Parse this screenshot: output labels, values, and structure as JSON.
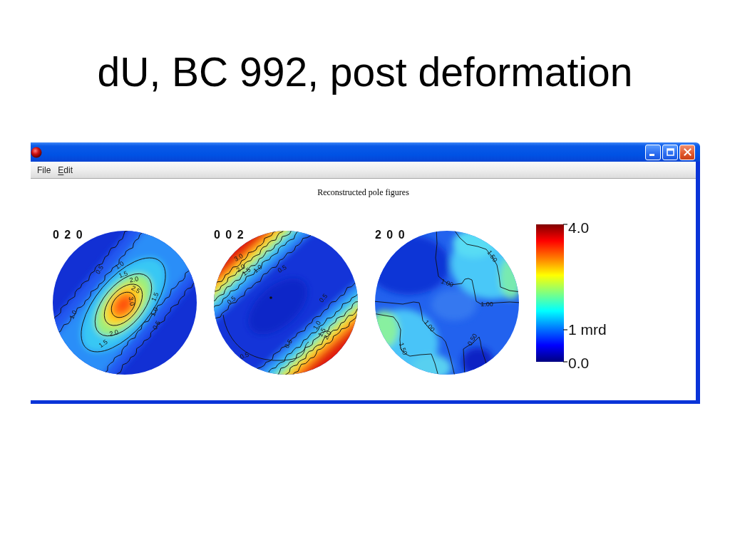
{
  "slide": {
    "title": "dU, BC 992, post deformation"
  },
  "window": {
    "menu": [
      {
        "label": "File",
        "mnemonic": false
      },
      {
        "label": "Edit",
        "mnemonic": true
      }
    ]
  },
  "plot": {
    "title": "Reconstructed pole figures",
    "pole_figures": [
      {
        "kind": "central-peak",
        "label": "0 2 0",
        "contour_labels": [
          "1.0",
          "0.5",
          "1.5",
          "2.0",
          "2.5",
          "1.5",
          "3.0",
          "1.0",
          "1.0",
          "0.5",
          "2.0",
          "1.5"
        ]
      },
      {
        "kind": "edge-bands",
        "label": "0 0 2",
        "contour_labels": [
          "3.0",
          "2.0",
          "1.0",
          "0.5",
          "1.5",
          "0.5",
          "0.5",
          "1.0",
          "1.5",
          "2.0",
          "0.5",
          "0.5"
        ]
      },
      {
        "kind": "patchy",
        "label": "2 0 0",
        "contour_labels": [
          "1.50",
          "1.00",
          "1.00",
          "1.00",
          "0.50",
          "1.50"
        ]
      }
    ],
    "colorbar": {
      "ticks": [
        "4.0",
        "1 mrd",
        "0.0"
      ]
    }
  }
}
